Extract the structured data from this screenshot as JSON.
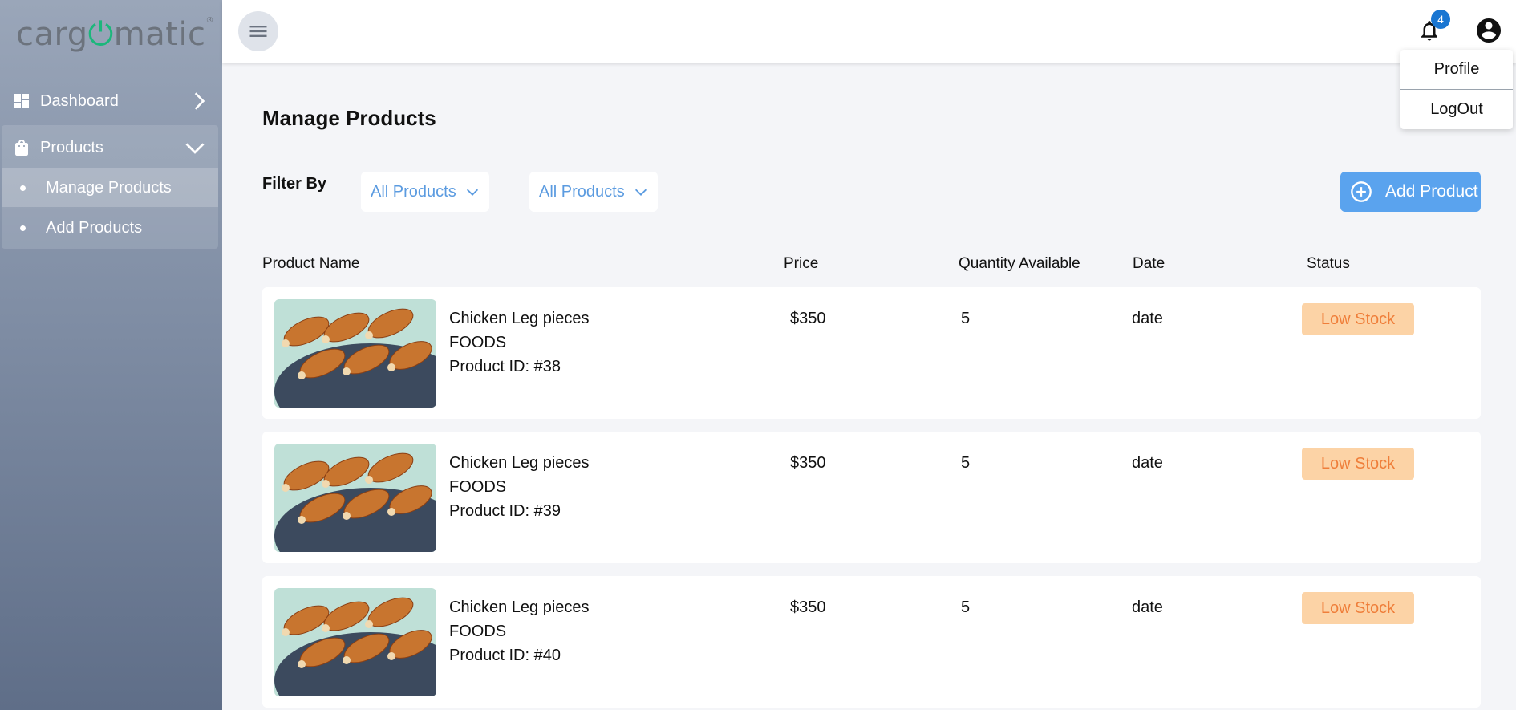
{
  "brand": {
    "logo_left": "carg",
    "logo_power": "⏻",
    "logo_right": "matic",
    "logo_mark": "®"
  },
  "sidebar": {
    "items": [
      {
        "label": "Dashboard",
        "icon": "dashboard-icon"
      },
      {
        "label": "Products",
        "icon": "shopping-bag-icon",
        "expanded": true,
        "children": [
          {
            "label": "Manage Products",
            "active": true
          },
          {
            "label": "Add Products",
            "active": false
          }
        ]
      }
    ]
  },
  "header": {
    "notification_count": "4",
    "user_menu": {
      "items": [
        "Profile",
        "LogOut"
      ]
    }
  },
  "page": {
    "title": "Manage Products",
    "filter_label": "Filter By",
    "filters": [
      "All Products",
      "All Products"
    ],
    "add_button": "Add Product"
  },
  "table": {
    "headers": [
      "Product Name",
      "Price",
      "Quantity Available",
      "Date",
      "Status"
    ],
    "rows": [
      {
        "name": "Chicken Leg pieces",
        "category": "FOODS",
        "product_id": "Product ID: #38",
        "price": "$350",
        "quantity": "5",
        "date": "date",
        "status": "Low Stock"
      },
      {
        "name": "Chicken Leg pieces",
        "category": "FOODS",
        "product_id": "Product ID: #39",
        "price": "$350",
        "quantity": "5",
        "date": "date",
        "status": "Low Stock"
      },
      {
        "name": "Chicken Leg pieces",
        "category": "FOODS",
        "product_id": "Product ID: #40",
        "price": "$350",
        "quantity": "5",
        "date": "date",
        "status": "Low Stock"
      }
    ]
  },
  "colors": {
    "accent": "#5aa3ee",
    "badge": "#1976d2",
    "status_bg": "#fcd3a6",
    "status_text": "#ef7e3a",
    "brand_power": "#1bb77b"
  }
}
